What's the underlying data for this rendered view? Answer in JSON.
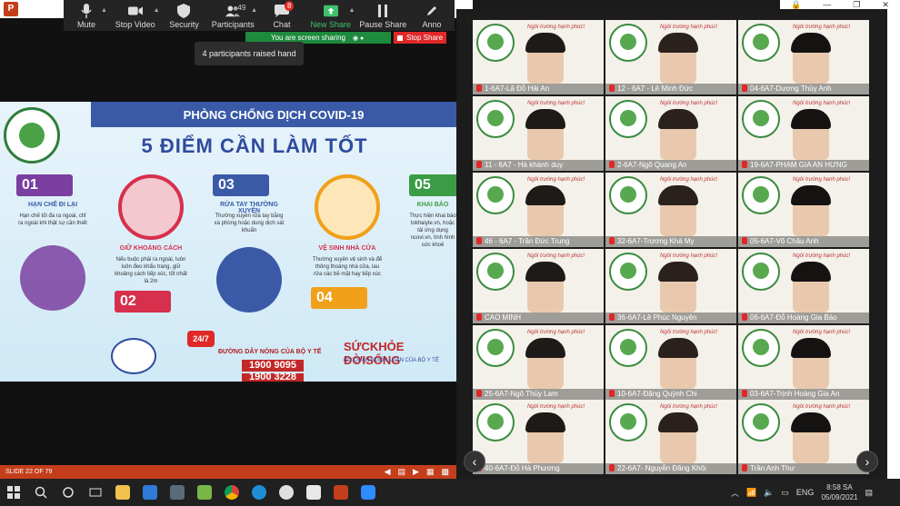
{
  "zoom_toolbar": {
    "mute": "Mute",
    "stop_video": "Stop Video",
    "security": "Security",
    "participants": "Participants",
    "participants_count": "49",
    "chat": "Chat",
    "chat_badge": "8",
    "new_share": "New Share",
    "pause_share": "Pause Share",
    "annotate": "Anno"
  },
  "share_status": {
    "banner": "You are screen sharing",
    "stop_share": "Stop Share"
  },
  "toast": "4 participants raised hand",
  "slide": {
    "header": "PHÒNG CHỐNG DỊCH COVID-19",
    "title": "5 ĐIỂM CẦN LÀM TỐT",
    "cards": [
      {
        "num": "01",
        "head": "HẠN CHẾ ĐI LẠI",
        "body": "Hạn chế tối đa ra ngoài, chỉ ra ngoài khi thật sự cần thiết",
        "color": "#7a3fa0"
      },
      {
        "num": "02",
        "head": "GIỮ KHOẢNG CÁCH",
        "body": "Nếu buộc phải ra ngoài, luôn luôn đeo khẩu trang, giữ khoảng cách tiếp xúc, tốt nhất là 2m",
        "color": "#d6304d"
      },
      {
        "num": "03",
        "head": "RỬA TAY THƯỜNG XUYÊN",
        "body": "Thường xuyên rửa tay bằng xà phòng hoặc dung dịch sát khuẩn",
        "color": "#3a5aa8"
      },
      {
        "num": "04",
        "head": "VỆ SINH NHÀ CỬA",
        "body": "Thường xuyên vệ sinh và để thông thoáng nhà cửa, lau rửa các bề mặt hay tiếp xúc",
        "color": "#f0a019"
      },
      {
        "num": "05",
        "head": "KHAI BÁO",
        "body": "Thực hiện khai báo tokhaiyte.vn, hoặc tải ứng dụng ncovi.vn, tình hình sức khoẻ",
        "color": "#3a9c45"
      }
    ],
    "hotline_title": "ĐƯỜNG DÂY NÓNG CỦA BỘ Y TẾ",
    "hotline_1": "1900 9095",
    "hotline_2": "1900 3228",
    "badge_247": "24/7",
    "brand": "SỨCKHỎE ĐỜISỐNG",
    "brand_sub": "CƠ QUAN NGÔN LUẬN CỦA BỘ Y TẾ"
  },
  "slide_status": "SLIDE 22 OF 79",
  "tile_motto": "Ngôi trường hạnh phúc!",
  "participants": [
    "1-6A7-Lã Đỗ Hải An",
    "12 - 6A7 - Lê Minh Đức",
    "04-6A7-Dương Thùy Anh",
    "11 - 6A7 - Hà khánh duy",
    "2-6A7-Ngô Quang An",
    "19-6A7-PHẠM GIA AN HƯNG",
    "46 - 6A7 - Trần Đức Trung",
    "32-6A7-Trương Khả My",
    "05-6A7-Võ Châu Anh",
    "CAO MINH",
    "36-6A7-Lê Phúc Nguyên",
    "06-6A7-Đỗ Hoàng Gia Bảo",
    "25-6A7-Ngô Thùy Lam",
    "10-6A7-Đặng Quỳnh Chi",
    "03-6A7-Trịnh Hoàng Gia An",
    "40-6A7-Đỗ Hà Phương",
    "22-6A7- Nguyễn Đăng Khôi",
    "Trần Anh Thư"
  ],
  "taskbar": {
    "lang": "ENG",
    "time": "8:58 SA",
    "date": "05/09/2021"
  }
}
